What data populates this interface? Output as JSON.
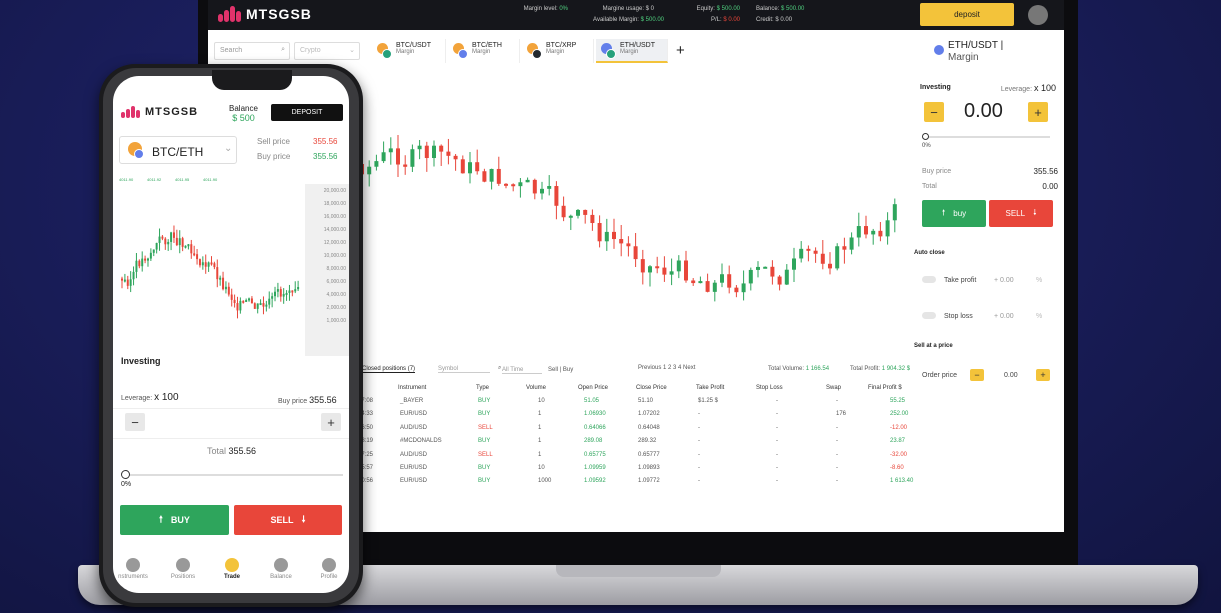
{
  "desktop": {
    "brand": "MTSGSB",
    "header": {
      "margin_level_label": "Margin level:",
      "margin_level_value": "0%",
      "margin_usage_label": "Margine usage:",
      "margin_usage_value": "$ 0",
      "available_margin_label": "Available Margin:",
      "available_margin_value": "$ 500.00",
      "equity_label": "Equity:",
      "equity_value": "$ 500.00",
      "pl_label": "P/L:",
      "pl_value": "$ 0.00",
      "balance_label": "Balance:",
      "balance_value": "$ 500.00",
      "credit_label": "Credit:",
      "credit_value": "$ 0.00",
      "deposit_label": "deposit"
    },
    "filters": {
      "search_placeholder": "Search",
      "category": "Crypto"
    },
    "pair_tabs": [
      {
        "pair": "BTC/USDT",
        "type": "Margin",
        "active": false
      },
      {
        "pair": "BTC/ETH",
        "type": "Margin",
        "active": false
      },
      {
        "pair": "BTC/XRP",
        "type": "Margin",
        "active": false
      },
      {
        "pair": "ETH/USDT",
        "type": "Margin",
        "active": true
      }
    ],
    "add_tab": "+",
    "side_panel": {
      "title": "ETH/USDT |",
      "subtitle": "Margin",
      "investing_label": "Investing",
      "leverage_label": "Leverage:",
      "leverage_value": "x 100",
      "minus": "−",
      "plus": "+",
      "amount": "0.00",
      "slider_value": "0%",
      "buy_price_label": "Buy price",
      "buy_price_value": "355.56",
      "total_label": "Total",
      "total_value": "0.00",
      "buy_label": "buy",
      "sell_label": "SELL",
      "auto_close_label": "Auto close",
      "take_profit_label": "Take profit",
      "take_profit_value": "+ 0.00",
      "stop_loss_label": "Stop loss",
      "stop_loss_value": "+ 0.00",
      "percent_unit": "%",
      "sell_at_price_label": "Sell at a price",
      "order_price_label": "Order price",
      "order_price_value": "0.00"
    },
    "positions": {
      "tab_label": "Closed positions (7)",
      "symbol_label": "Symbol",
      "time_filter": "All Time",
      "sell_label": "Sell",
      "buy_label": "Buy",
      "pagination": "Previous  1  2  3  4  Next",
      "total_volume_label": "Total Volume:",
      "total_volume_value": "1 166.54",
      "total_profit_label": "Total Profit:",
      "total_profit_value": "1 904.32 $",
      "columns": [
        "Instrument",
        "Type",
        "Volume",
        "Open Price",
        "Close Price",
        "Take Profit",
        "Stop Loss",
        "Swap",
        "Final Profit $"
      ],
      "rows": [
        {
          "time": "07:08",
          "instrument": "_BAYER",
          "type": "BUY",
          "volume": "10",
          "open": "51.05",
          "close": "51.10",
          "tp": "$1.25 $",
          "sl": "-",
          "swap": "-",
          "profit": "55.25"
        },
        {
          "time": "04:33",
          "instrument": "EUR/USD",
          "type": "BUY",
          "volume": "1",
          "open": "1.06930",
          "close": "1.07202",
          "tp": "-",
          "sl": "-",
          "swap": "176",
          "profit": "252.00"
        },
        {
          "time": "06:50",
          "instrument": "AUD/USD",
          "type": "SELL",
          "volume": "1",
          "open": "0.64066",
          "close": "0.64048",
          "tp": "-",
          "sl": "-",
          "swap": "-",
          "profit": "-12.00"
        },
        {
          "time": "48:19",
          "instrument": "#MCDONALDS",
          "type": "BUY",
          "volume": "1",
          "open": "289.08",
          "close": "289.32",
          "tp": "-",
          "sl": "-",
          "swap": "-",
          "profit": "23.87"
        },
        {
          "time": "57:25",
          "instrument": "AUD/USD",
          "type": "SELL",
          "volume": "1",
          "open": "0.65775",
          "close": "0.65777",
          "tp": "-",
          "sl": "-",
          "swap": "-",
          "profit": "-32.00"
        },
        {
          "time": "55:57",
          "instrument": "EUR/USD",
          "type": "BUY",
          "volume": "10",
          "open": "1.09959",
          "close": "1.09893",
          "tp": "-",
          "sl": "-",
          "swap": "-",
          "profit": "-8.60"
        },
        {
          "time": "30:56",
          "instrument": "EUR/USD",
          "type": "BUY",
          "volume": "1000",
          "open": "1.09592",
          "close": "1.09772",
          "tp": "-",
          "sl": "-",
          "swap": "-",
          "profit": "1 613.40"
        }
      ]
    }
  },
  "mobile": {
    "brand": "MTSGSB",
    "balance_label": "Balance",
    "balance_value": "$ 500",
    "deposit_label": "DEPOSIT",
    "pair": "BTC/ETH",
    "sell_price_label": "Sell price",
    "sell_price_value": "355.56",
    "buy_price_label": "Buy price",
    "buy_price_value": "355.56",
    "mini_stats": [
      "4011.90",
      "4011.92",
      "4011.95",
      "4011.90"
    ],
    "price_axis": [
      "20,000.00",
      "18,000.00",
      "16,000.00",
      "14,000.00",
      "12,000.00",
      "10,000.00",
      "8,000.00",
      "6,000.00",
      "4,000.00",
      "2,000.00",
      "1,000.00"
    ],
    "investing_label": "Investing",
    "leverage_label": "Leverage:",
    "leverage_value": "x 100",
    "buy_price_label2": "Buy price",
    "buy_price_value2": "355.56",
    "minus": "−",
    "plus": "+",
    "total_label": "Total",
    "total_value": "355.56",
    "slider_value": "0%",
    "buy_label": "BUY",
    "sell_label": "SELL",
    "tabs": [
      "nstruments",
      "Positions",
      "Trade",
      "Balance",
      "Profile"
    ]
  },
  "colors": {
    "accent": "#f3c33a",
    "buy": "#2ea55c",
    "sell": "#e8463a",
    "brand": "#e0336b",
    "positive": "#4fd07f"
  }
}
